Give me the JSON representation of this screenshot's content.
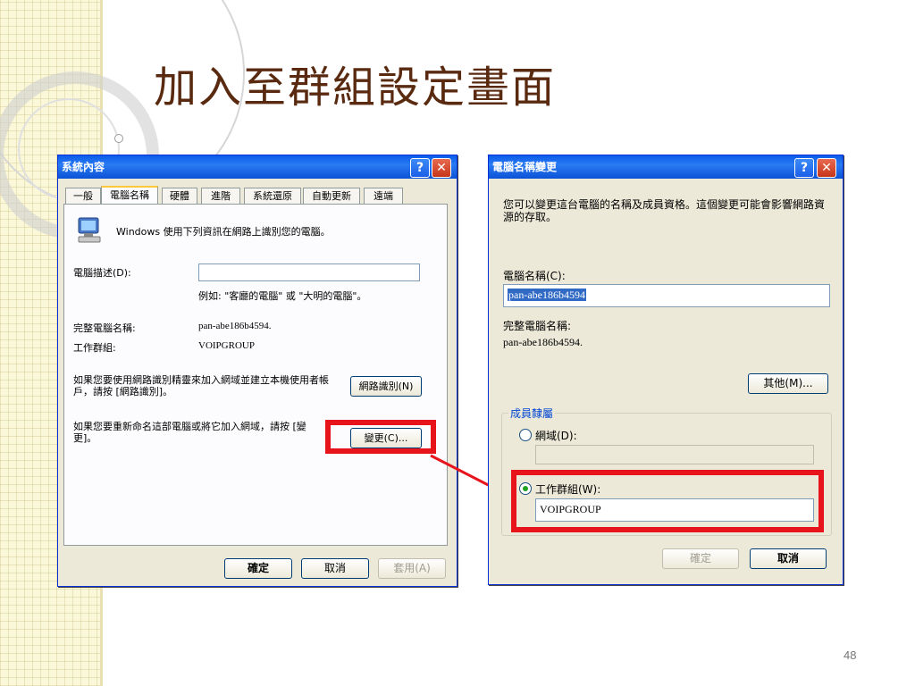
{
  "slide": {
    "title": "加入至群組設定畫面",
    "page_number": "48"
  },
  "left_dialog": {
    "title": "系統內容",
    "tabs": [
      "一般",
      "電腦名稱",
      "硬體",
      "進階",
      "系統還原",
      "自動更新",
      "遠端"
    ],
    "description": "Windows 使用下列資訊在網路上識別您的電腦。",
    "computer_description_label": "電腦描述(D):",
    "computer_description_value": "",
    "example": "例如: \"客廳的電腦\" 或 \"大明的電腦\"。",
    "full_name_label": "完整電腦名稱:",
    "full_name_value": "pan-abe186b4594.",
    "workgroup_label": "工作群組:",
    "workgroup_value": "VOIPGROUP",
    "network_id_text": "如果您要使用網路識別精靈來加入網域並建立本機使用者帳戶，請按 [網路識別]。",
    "network_id_button": "網路識別(N)",
    "rename_text": "如果您要重新命名這部電腦或將它加入網域，請按 [變更]。",
    "change_button": "變更(C)...",
    "ok_button": "確定",
    "cancel_button": "取消",
    "apply_button": "套用(A)"
  },
  "right_dialog": {
    "title": "電腦名稱變更",
    "description": "您可以變更這台電腦的名稱及成員資格。這個變更可能會影響網路資源的存取。",
    "computer_name_label": "電腦名稱(C):",
    "computer_name_value": "pan-abe186b4594",
    "full_name_label": "完整電腦名稱:",
    "full_name_value": "pan-abe186b4594.",
    "more_button": "其他(M)...",
    "member_of_label": "成員隸屬",
    "domain_label": "網域(D):",
    "domain_value": "",
    "workgroup_label": "工作群組(W):",
    "workgroup_value": "VOIPGROUP",
    "ok_button": "確定",
    "cancel_button": "取消"
  },
  "colors": {
    "highlight": "#e8141c",
    "title": "#5a2a10",
    "xp_blue": "#0a5ce8"
  },
  "icons": [
    "help-icon",
    "close-icon",
    "computer-icon",
    "arrow-icon"
  ]
}
